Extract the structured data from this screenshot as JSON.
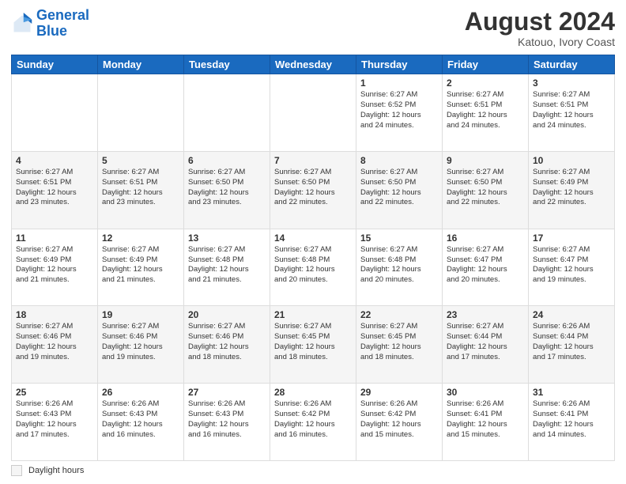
{
  "header": {
    "logo_line1": "General",
    "logo_line2": "Blue",
    "month": "August 2024",
    "location": "Katouo, Ivory Coast"
  },
  "days_of_week": [
    "Sunday",
    "Monday",
    "Tuesday",
    "Wednesday",
    "Thursday",
    "Friday",
    "Saturday"
  ],
  "weeks": [
    [
      {
        "day": "",
        "info": ""
      },
      {
        "day": "",
        "info": ""
      },
      {
        "day": "",
        "info": ""
      },
      {
        "day": "",
        "info": ""
      },
      {
        "day": "1",
        "info": "Sunrise: 6:27 AM\nSunset: 6:52 PM\nDaylight: 12 hours\nand 24 minutes."
      },
      {
        "day": "2",
        "info": "Sunrise: 6:27 AM\nSunset: 6:51 PM\nDaylight: 12 hours\nand 24 minutes."
      },
      {
        "day": "3",
        "info": "Sunrise: 6:27 AM\nSunset: 6:51 PM\nDaylight: 12 hours\nand 24 minutes."
      }
    ],
    [
      {
        "day": "4",
        "info": "Sunrise: 6:27 AM\nSunset: 6:51 PM\nDaylight: 12 hours\nand 23 minutes."
      },
      {
        "day": "5",
        "info": "Sunrise: 6:27 AM\nSunset: 6:51 PM\nDaylight: 12 hours\nand 23 minutes."
      },
      {
        "day": "6",
        "info": "Sunrise: 6:27 AM\nSunset: 6:50 PM\nDaylight: 12 hours\nand 23 minutes."
      },
      {
        "day": "7",
        "info": "Sunrise: 6:27 AM\nSunset: 6:50 PM\nDaylight: 12 hours\nand 22 minutes."
      },
      {
        "day": "8",
        "info": "Sunrise: 6:27 AM\nSunset: 6:50 PM\nDaylight: 12 hours\nand 22 minutes."
      },
      {
        "day": "9",
        "info": "Sunrise: 6:27 AM\nSunset: 6:50 PM\nDaylight: 12 hours\nand 22 minutes."
      },
      {
        "day": "10",
        "info": "Sunrise: 6:27 AM\nSunset: 6:49 PM\nDaylight: 12 hours\nand 22 minutes."
      }
    ],
    [
      {
        "day": "11",
        "info": "Sunrise: 6:27 AM\nSunset: 6:49 PM\nDaylight: 12 hours\nand 21 minutes."
      },
      {
        "day": "12",
        "info": "Sunrise: 6:27 AM\nSunset: 6:49 PM\nDaylight: 12 hours\nand 21 minutes."
      },
      {
        "day": "13",
        "info": "Sunrise: 6:27 AM\nSunset: 6:48 PM\nDaylight: 12 hours\nand 21 minutes."
      },
      {
        "day": "14",
        "info": "Sunrise: 6:27 AM\nSunset: 6:48 PM\nDaylight: 12 hours\nand 20 minutes."
      },
      {
        "day": "15",
        "info": "Sunrise: 6:27 AM\nSunset: 6:48 PM\nDaylight: 12 hours\nand 20 minutes."
      },
      {
        "day": "16",
        "info": "Sunrise: 6:27 AM\nSunset: 6:47 PM\nDaylight: 12 hours\nand 20 minutes."
      },
      {
        "day": "17",
        "info": "Sunrise: 6:27 AM\nSunset: 6:47 PM\nDaylight: 12 hours\nand 19 minutes."
      }
    ],
    [
      {
        "day": "18",
        "info": "Sunrise: 6:27 AM\nSunset: 6:46 PM\nDaylight: 12 hours\nand 19 minutes."
      },
      {
        "day": "19",
        "info": "Sunrise: 6:27 AM\nSunset: 6:46 PM\nDaylight: 12 hours\nand 19 minutes."
      },
      {
        "day": "20",
        "info": "Sunrise: 6:27 AM\nSunset: 6:46 PM\nDaylight: 12 hours\nand 18 minutes."
      },
      {
        "day": "21",
        "info": "Sunrise: 6:27 AM\nSunset: 6:45 PM\nDaylight: 12 hours\nand 18 minutes."
      },
      {
        "day": "22",
        "info": "Sunrise: 6:27 AM\nSunset: 6:45 PM\nDaylight: 12 hours\nand 18 minutes."
      },
      {
        "day": "23",
        "info": "Sunrise: 6:27 AM\nSunset: 6:44 PM\nDaylight: 12 hours\nand 17 minutes."
      },
      {
        "day": "24",
        "info": "Sunrise: 6:26 AM\nSunset: 6:44 PM\nDaylight: 12 hours\nand 17 minutes."
      }
    ],
    [
      {
        "day": "25",
        "info": "Sunrise: 6:26 AM\nSunset: 6:43 PM\nDaylight: 12 hours\nand 17 minutes."
      },
      {
        "day": "26",
        "info": "Sunrise: 6:26 AM\nSunset: 6:43 PM\nDaylight: 12 hours\nand 16 minutes."
      },
      {
        "day": "27",
        "info": "Sunrise: 6:26 AM\nSunset: 6:43 PM\nDaylight: 12 hours\nand 16 minutes."
      },
      {
        "day": "28",
        "info": "Sunrise: 6:26 AM\nSunset: 6:42 PM\nDaylight: 12 hours\nand 16 minutes."
      },
      {
        "day": "29",
        "info": "Sunrise: 6:26 AM\nSunset: 6:42 PM\nDaylight: 12 hours\nand 15 minutes."
      },
      {
        "day": "30",
        "info": "Sunrise: 6:26 AM\nSunset: 6:41 PM\nDaylight: 12 hours\nand 15 minutes."
      },
      {
        "day": "31",
        "info": "Sunrise: 6:26 AM\nSunset: 6:41 PM\nDaylight: 12 hours\nand 14 minutes."
      }
    ]
  ],
  "footer": {
    "daylight_label": "Daylight hours"
  }
}
